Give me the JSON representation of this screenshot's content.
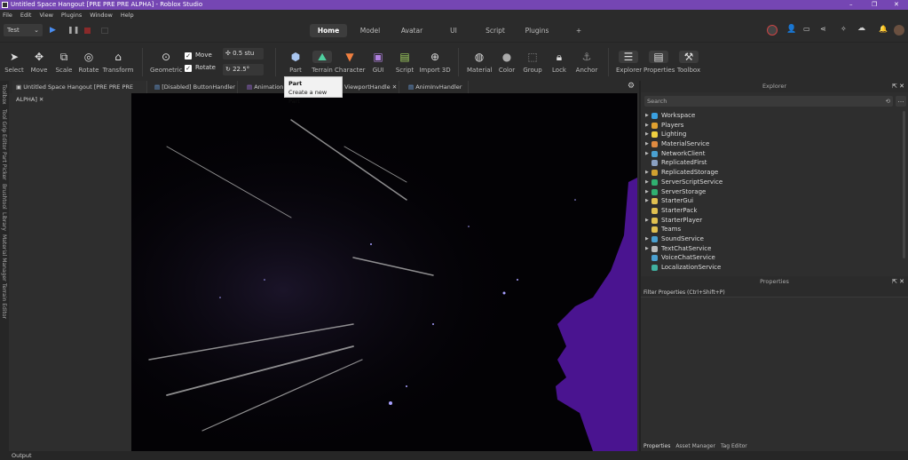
{
  "window": {
    "title": "Untitled Space Hangout [PRE PRE PRE ALPHA] - Roblox Studio",
    "minimize": "–",
    "maximize": "❐",
    "close": "✕"
  },
  "menu": [
    "File",
    "Edit",
    "View",
    "Plugins",
    "Window",
    "Help"
  ],
  "ribbon": {
    "test_select": "Test",
    "tabs": [
      "Home",
      "Model",
      "Avatar",
      "UI",
      "Script",
      "Plugins",
      "+"
    ],
    "active_tab": "Home"
  },
  "tools": {
    "select": "Select",
    "move": "Move",
    "scale": "Scale",
    "rotate": "Rotate",
    "transform": "Transform",
    "geometric": "Geometric",
    "move_check": "Move",
    "rotate_check": "Rotate",
    "move_step": "0.5 stu",
    "rotate_step": "22.5°",
    "part": "Part",
    "terrain": "Terrain",
    "character": "Character",
    "gui": "GUI",
    "script": "Script",
    "import3d": "Import 3D",
    "material": "Material",
    "color": "Color",
    "group": "Group",
    "lock": "Lock",
    "anchor": "Anchor",
    "explorer": "Explorer",
    "properties": "Properties",
    "toolbox": "Toolbox"
  },
  "tooltip": {
    "title": "Part",
    "desc": "Create a new Part"
  },
  "doc_tabs": [
    "Untitled Space Hangout [PRE PRE PRE ALPHA]",
    "[Disabled] ButtonHandler",
    "AnimationP",
    "ViewportHandle",
    "AnimInvHandler"
  ],
  "left_tabs": [
    "Toolbox",
    "Tool Grip Editor",
    "Part Picker",
    "Brushtool",
    "Library",
    "Material Manager",
    "Terrain Editor"
  ],
  "explorer": {
    "title": "Explorer",
    "search_placeholder": "Search",
    "items": [
      {
        "name": "Workspace",
        "color": "#3aa0e0",
        "arrow": true
      },
      {
        "name": "Players",
        "color": "#e0a030",
        "arrow": true
      },
      {
        "name": "Lighting",
        "color": "#f0d040",
        "arrow": true
      },
      {
        "name": "MaterialService",
        "color": "#e08a40",
        "arrow": true
      },
      {
        "name": "NetworkClient",
        "color": "#4aa0d0",
        "arrow": true
      },
      {
        "name": "ReplicatedFirst",
        "color": "#8aa0c0",
        "arrow": false
      },
      {
        "name": "ReplicatedStorage",
        "color": "#d0a030",
        "arrow": true
      },
      {
        "name": "ServerScriptService",
        "color": "#30b070",
        "arrow": true
      },
      {
        "name": "ServerStorage",
        "color": "#30b070",
        "arrow": true
      },
      {
        "name": "StarterGui",
        "color": "#e0c050",
        "arrow": true
      },
      {
        "name": "StarterPack",
        "color": "#e0c050",
        "arrow": false
      },
      {
        "name": "StarterPlayer",
        "color": "#e0c050",
        "arrow": true
      },
      {
        "name": "Teams",
        "color": "#e0c050",
        "arrow": false
      },
      {
        "name": "SoundService",
        "color": "#4aa0d0",
        "arrow": true
      },
      {
        "name": "TextChatService",
        "color": "#bbbbbb",
        "arrow": true
      },
      {
        "name": "VoiceChatService",
        "color": "#4aa0d0",
        "arrow": false
      },
      {
        "name": "LocalizationService",
        "color": "#40b0a0",
        "arrow": false
      }
    ]
  },
  "properties": {
    "title": "Properties",
    "filter_placeholder": "Filter Properties (Ctrl+Shift+P)",
    "bottom_tabs": [
      "Properties",
      "Asset Manager",
      "Tag Editor"
    ]
  },
  "output": "Output"
}
